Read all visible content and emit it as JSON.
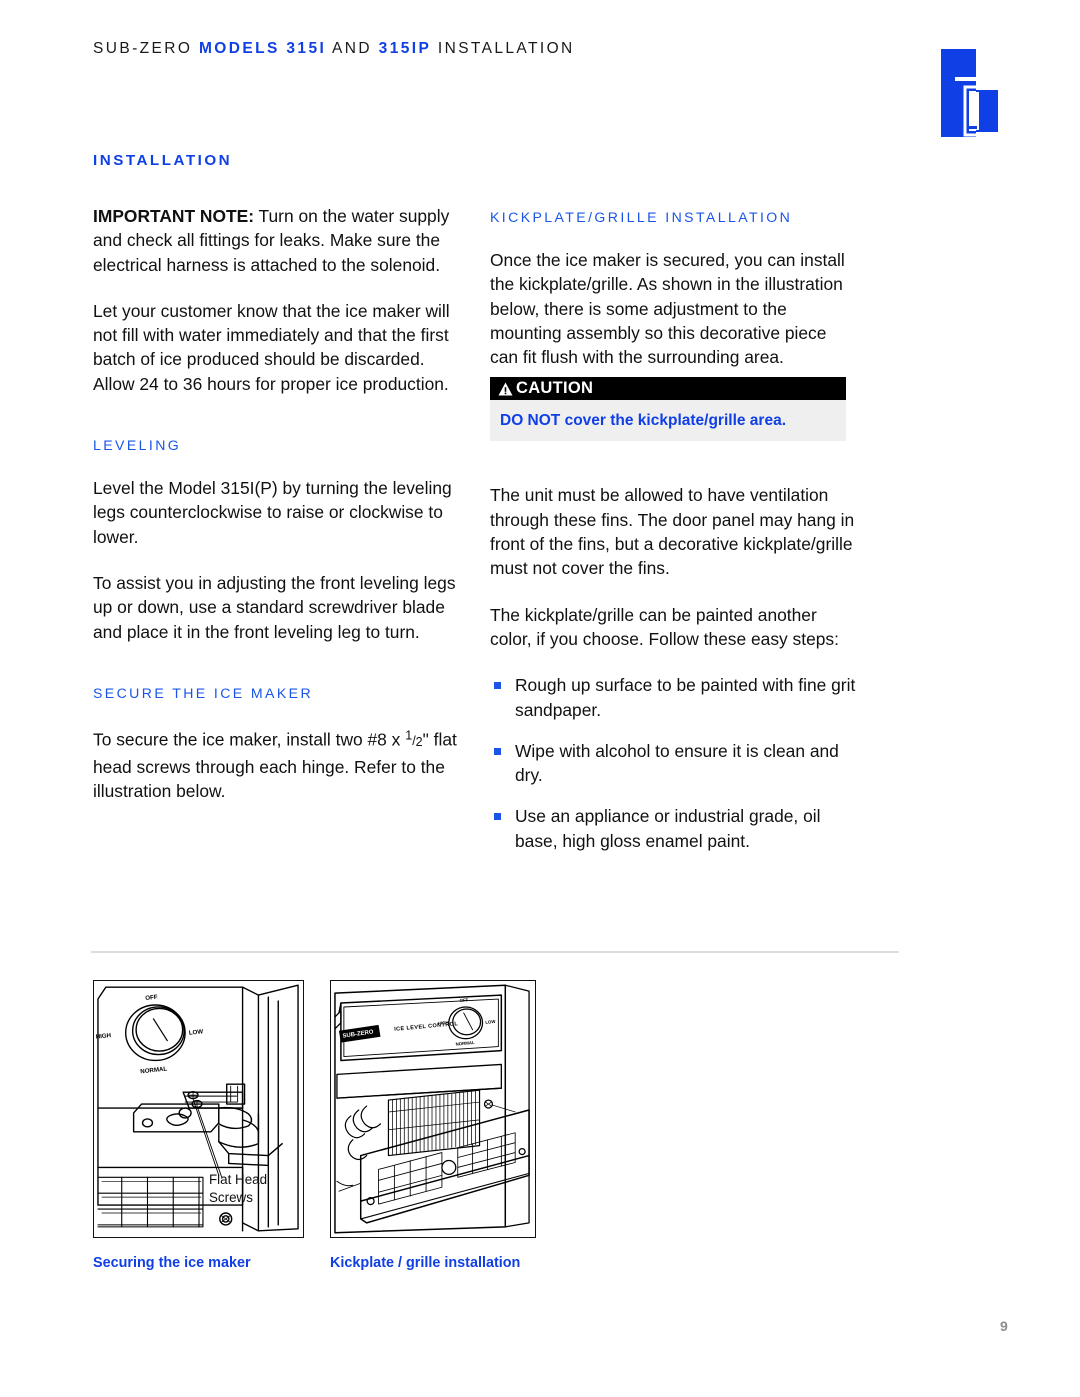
{
  "header": {
    "prefix": "SUB-ZERO ",
    "models_blue": "MODELS 315I",
    "and": " AND ",
    "model_blue_2": "315IP",
    "suffix": " INSTALLATION",
    "logo_name": "sub-zero-logo"
  },
  "left_column": {
    "section_title": "INSTALLATION",
    "important_note_label": "IMPORTANT NOTE:",
    "important_note_text": " Turn on the water supply and check all fittings for leaks. Make sure the electrical harness is attached to the solenoid.",
    "paragraph_2": "Let your customer know that the ice maker will not fill with water immediately and that the first batch of ice produced should be discarded. Allow 24 to 36 hours for proper ice production.",
    "leveling_title": "LEVELING",
    "leveling_p1": "Level the Model 315I(P) by turning the leveling legs counterclockwise to raise or clockwise to lower.",
    "leveling_p2": "To assist you in adjusting the front leveling legs up or down, use a standard screwdriver blade and place it in the front leveling leg to turn.",
    "secure_title": "SECURE THE ICE MAKER",
    "secure_p1_a": "To secure the ice maker, install two #8 x ",
    "secure_fraction_num": "1",
    "secure_fraction_den": "2",
    "secure_p1_b": "\" flat head screws through each hinge. Refer to the illustration below."
  },
  "right_column": {
    "kickplate_title": "KICKPLATE/GRILLE INSTALLATION",
    "kickplate_p1": "Once the ice maker is secured, you can install the kickplate/grille. As shown in the illustration below, there is some adjustment to the mounting assembly so this decorative piece can fit flush with the surrounding area.",
    "ventilation_p": "The unit must be allowed to have ventilation through these fins. The door panel may hang in front of the fins, but a decorative kickplate/grille must not cover the fins.",
    "painting_p": "The kickplate/grille can be painted another color, if you choose. Follow these easy steps:",
    "bullets": [
      "Rough up surface to be painted with fine grit sandpaper.",
      "Wipe with alcohol to ensure it is clean and dry.",
      "Use an appliance or industrial grade, oil base, high gloss enamel paint."
    ]
  },
  "caution": {
    "label": "CAUTION",
    "icon_name": "warning-triangle-icon",
    "message": "DO NOT cover the kickplate/grille area."
  },
  "figures": {
    "securing": {
      "caption": "Securing the ice maker",
      "callout": "Flat Head Screws",
      "dial_labels": {
        "off": "OFF",
        "high": "HIGH",
        "low": "LOW",
        "normal": "NORMAL"
      }
    },
    "kickplate": {
      "caption": "Kickplate / grille installation",
      "panel_label": "ICE LEVEL CONTROL",
      "brand_badge": "SUB-ZERO",
      "dial_labels": {
        "off": "OFF",
        "high": "HIGH",
        "low": "LOW",
        "normal": "NORMAL"
      }
    }
  },
  "footer": {
    "page_number": "9"
  },
  "colors": {
    "brand_blue": "#0f3fe5",
    "heading_blue": "#1a55e8",
    "caution_bar": "#000000",
    "caution_body": "#efefef",
    "divider": "#dcdcdc",
    "page_number": "#8c8c8c"
  }
}
